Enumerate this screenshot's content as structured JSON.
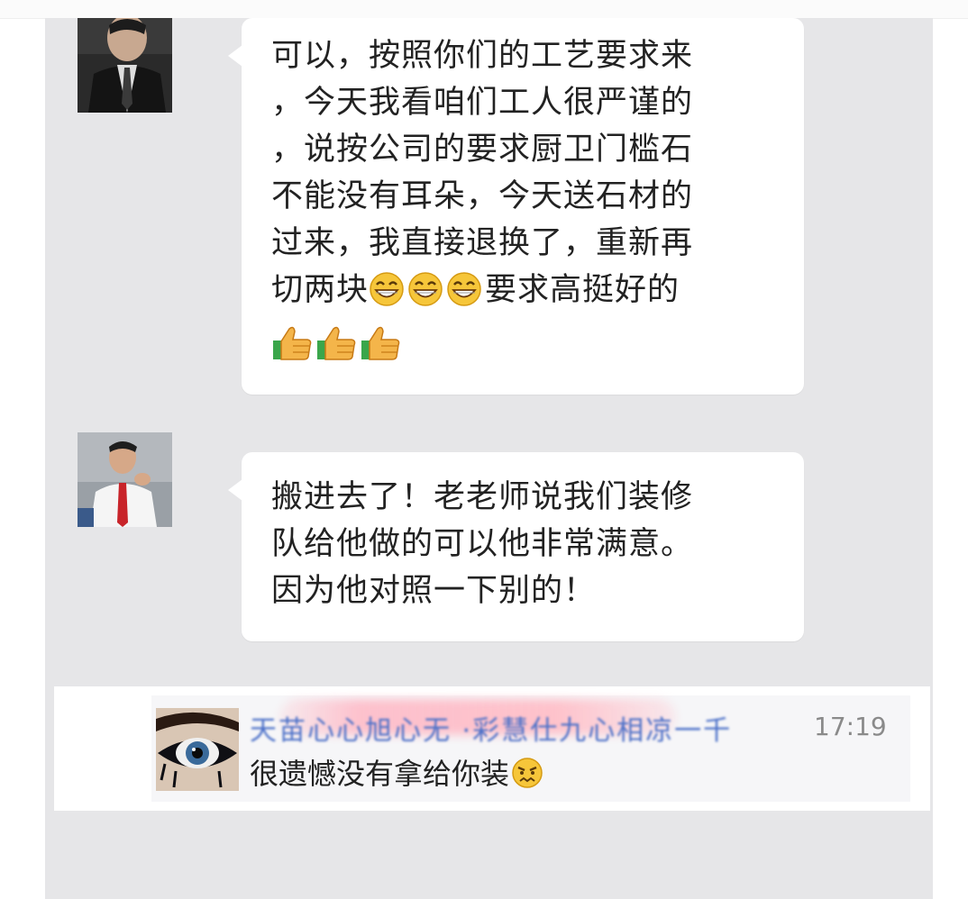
{
  "messages": [
    {
      "lines": [
        "可以，按照你们的工艺要求来",
        "，今天我看咱们工人很严谨的",
        "，说按公司的要求厨卫门槛石",
        "不能没有耳朵，今天送石材的",
        "过来，我直接退换了，重新再",
        "切两块",
        "要求高挺好的"
      ]
    },
    {
      "lines": [
        "搬进去了！老老师说我们装修",
        "队给他做的可以他非常满意。",
        "因为他对照一下别的！"
      ]
    }
  ],
  "quoted": {
    "sender_blurred": "天苗心心旭心无  ·彩慧仕九心相凉一千",
    "time": "17:19",
    "message": "很遗憾没有拿给你装"
  },
  "emoji_names": [
    "grin-emoji",
    "thumbs-up-emoji",
    "angry-emoji"
  ]
}
